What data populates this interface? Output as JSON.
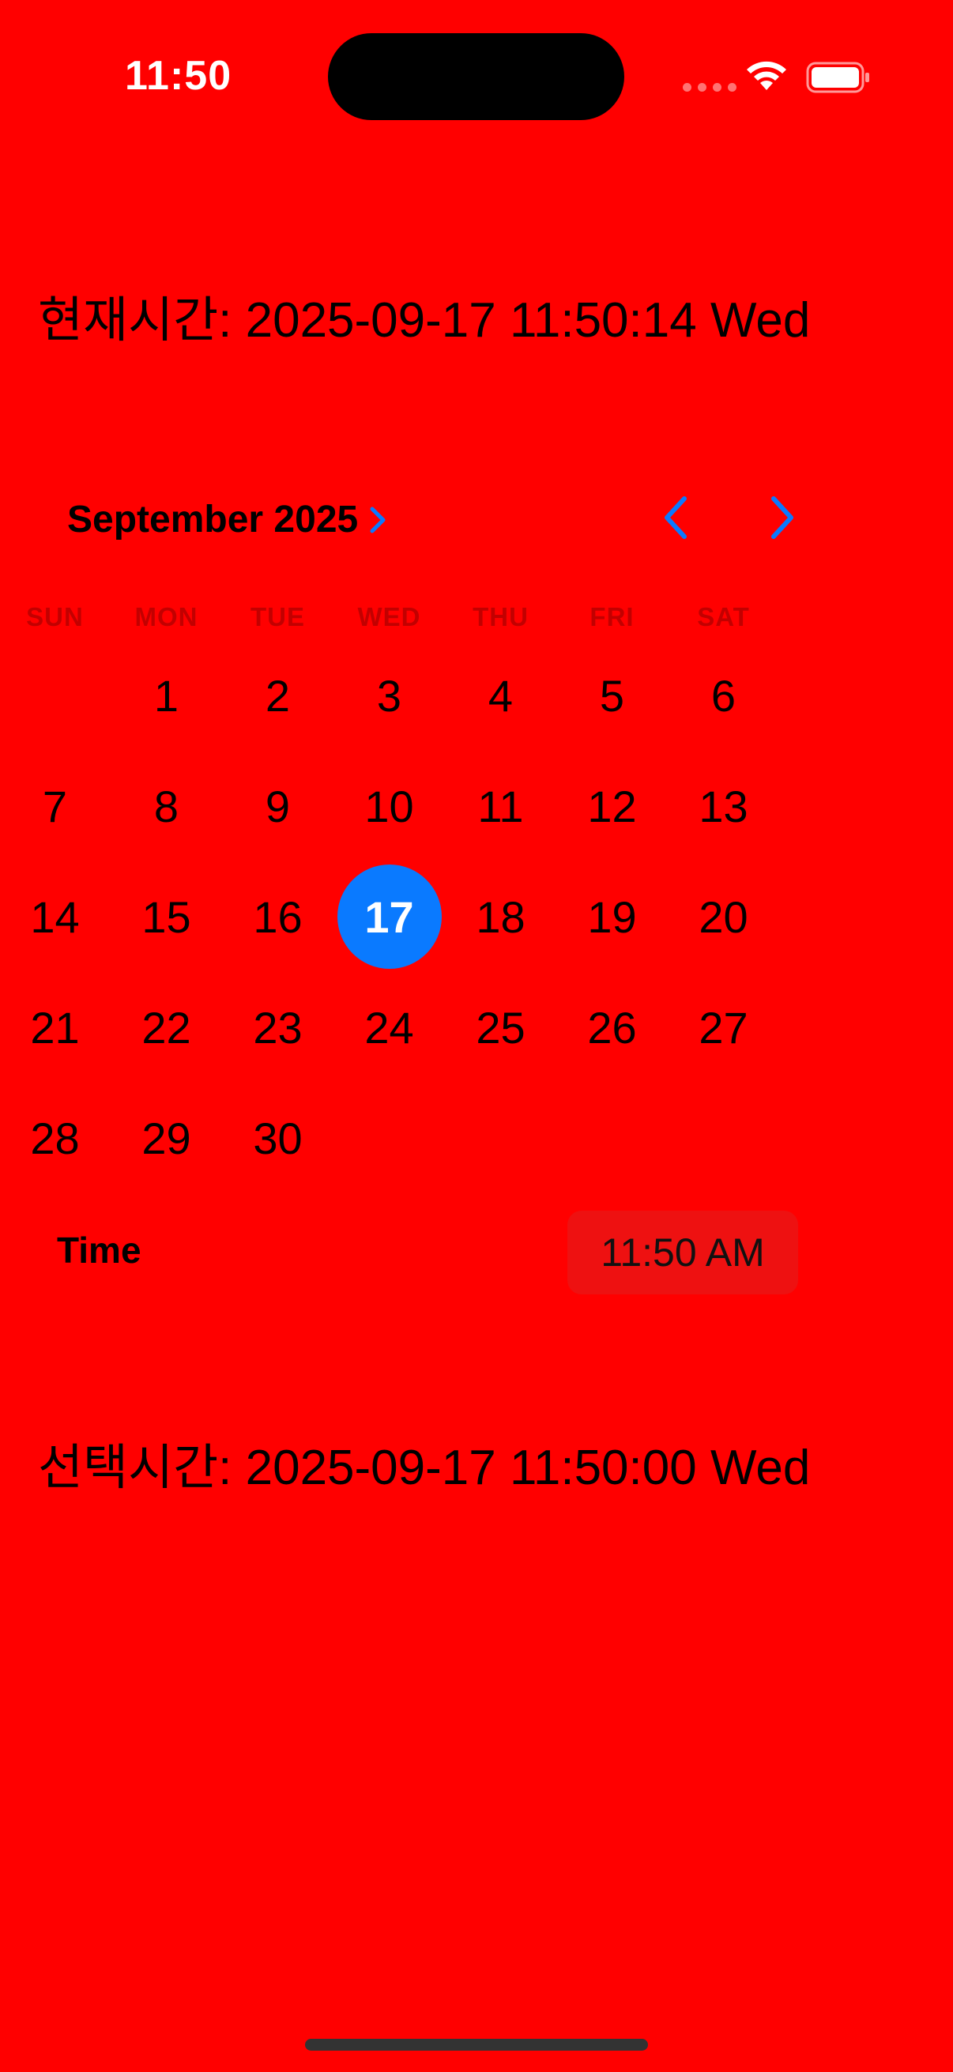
{
  "status_bar": {
    "time": "11:50"
  },
  "current_time_text": "현재시간: 2025-09-17 11:50:14 Wed",
  "calendar": {
    "month_label": "September 2025",
    "weekdays": [
      "SUN",
      "MON",
      "TUE",
      "WED",
      "THU",
      "FRI",
      "SAT"
    ],
    "days": [
      "",
      "1",
      "2",
      "3",
      "4",
      "5",
      "6",
      "7",
      "8",
      "9",
      "10",
      "11",
      "12",
      "13",
      "14",
      "15",
      "16",
      "17",
      "18",
      "19",
      "20",
      "21",
      "22",
      "23",
      "24",
      "25",
      "26",
      "27",
      "28",
      "29",
      "30"
    ],
    "selected_day": "17",
    "accent_color": "#0a7aff"
  },
  "time_row": {
    "label": "Time",
    "value": "11:50 AM"
  },
  "selected_time_text": "선택시간: 2025-09-17 11:50:00 Wed",
  "colors": {
    "background": "#ff0000",
    "accent": "#0a7aff"
  },
  "icons": {
    "status": [
      "cellular-dots-icon",
      "wifi-icon",
      "battery-icon"
    ],
    "month_chevron": "chevron-right-icon",
    "prev": "chevron-left-icon",
    "next": "chevron-right-icon"
  }
}
